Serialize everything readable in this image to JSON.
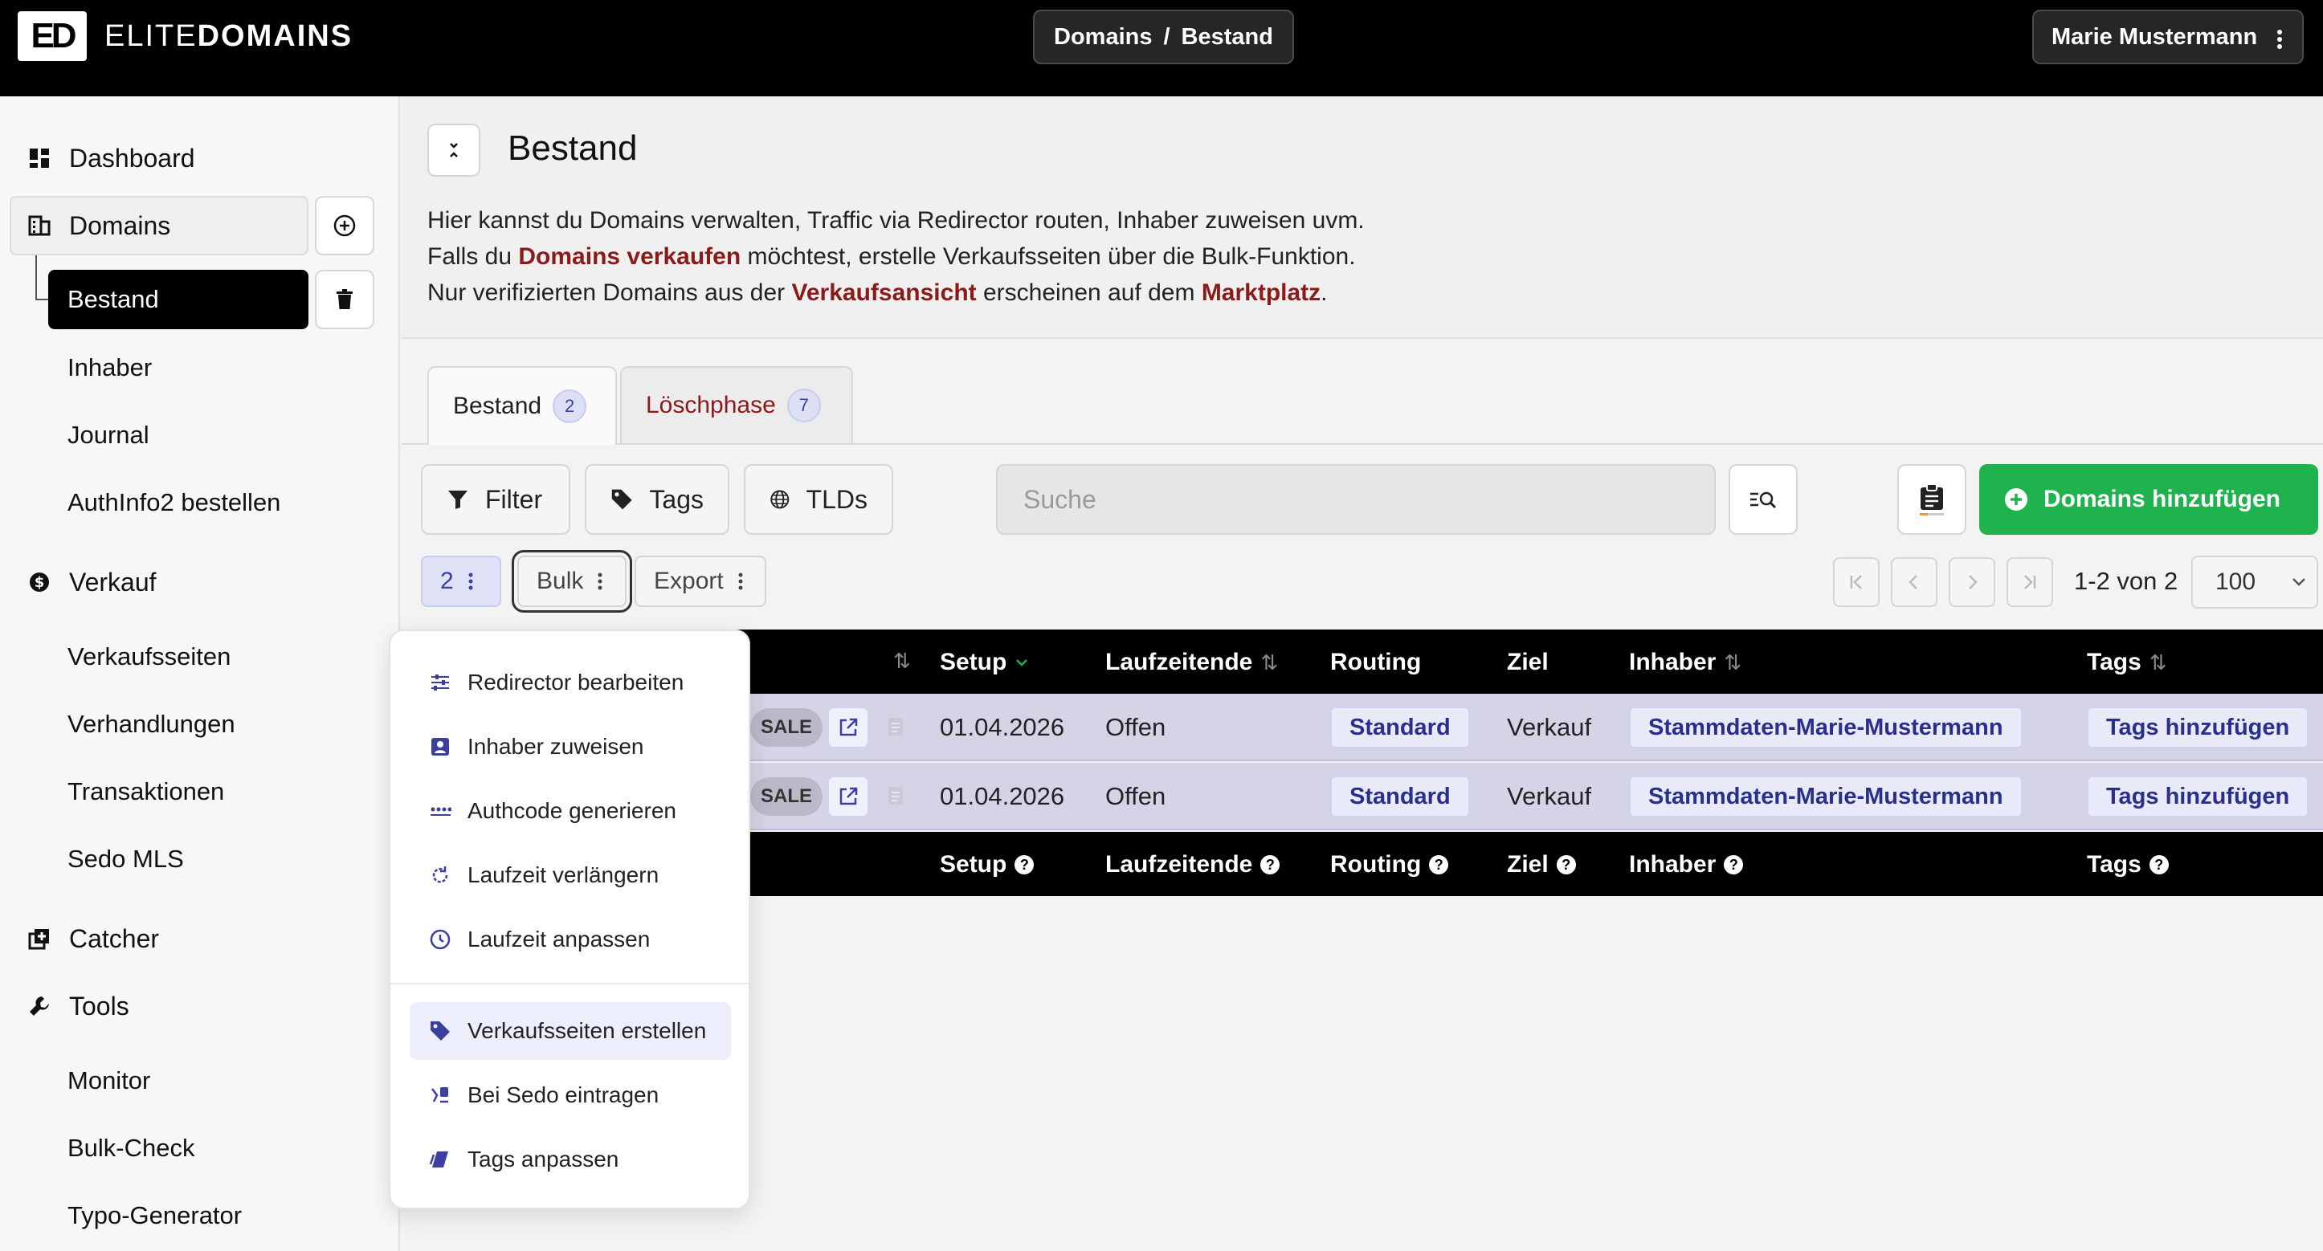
{
  "topbar": {
    "logo_mark": "ED",
    "logo_light": "ELITE",
    "logo_bold": "DOMAINS",
    "breadcrumb": [
      "Domains",
      "/",
      "Bestand"
    ],
    "user_name": "Marie Mustermann"
  },
  "sidebar": {
    "dashboard": "Dashboard",
    "domains": "Domains",
    "bestand": "Bestand",
    "inhaber": "Inhaber",
    "journal": "Journal",
    "authinfo": "AuthInfo2 bestellen",
    "verkauf": "Verkauf",
    "verkaufsseiten": "Verkaufsseiten",
    "verhandlungen": "Verhandlungen",
    "transaktionen": "Transaktionen",
    "sedo": "Sedo MLS",
    "catcher": "Catcher",
    "tools": "Tools",
    "monitor": "Monitor",
    "bulkcheck": "Bulk-Check",
    "typo": "Typo-Generator"
  },
  "header": {
    "title": "Bestand",
    "line1": "Hier kannst du Domains verwalten, Traffic via Redirector routen, Inhaber zuweisen uvm.",
    "line2_a": "Falls du ",
    "line2_link": "Domains verkaufen",
    "line2_b": " möchtest, erstelle Verkaufsseiten über die Bulk-Funktion.",
    "line3_a": "Nur verifizierten Domains aus der ",
    "line3_link1": "Verkaufsansicht",
    "line3_b": " erscheinen auf dem ",
    "line3_link2": "Marktplatz",
    "line3_c": "."
  },
  "tabs": [
    {
      "label": "Bestand",
      "count": "2"
    },
    {
      "label": "Löschphase",
      "count": "7"
    }
  ],
  "toolbar": {
    "filter": "Filter",
    "tags": "Tags",
    "tlds": "TLDs",
    "search_placeholder": "Suche",
    "add": "Domains hinzufügen",
    "selected_count": "2",
    "bulk": "Bulk",
    "export": "Export",
    "page_info": "1-2 von 2",
    "page_size": "100"
  },
  "table": {
    "headers": {
      "setup": "Setup",
      "laufzeitende": "Laufzeitende",
      "routing": "Routing",
      "ziel": "Ziel",
      "inhaber": "Inhaber",
      "tags": "Tags"
    },
    "rows": [
      {
        "sale": "SALE",
        "setup": "01.04.2026",
        "laufzeitende": "Offen",
        "routing": "Standard",
        "ziel": "Verkauf",
        "inhaber": "Stammdaten-Marie-Mustermann",
        "tags": "Tags hinzufügen"
      },
      {
        "sale": "SALE",
        "setup": "01.04.2026",
        "laufzeitende": "Offen",
        "routing": "Standard",
        "ziel": "Verkauf",
        "inhaber": "Stammdaten-Marie-Mustermann",
        "tags": "Tags hinzufügen"
      }
    ]
  },
  "bulk_menu": [
    {
      "label": "Redirector bearbeiten",
      "icon": "sliders-icon"
    },
    {
      "label": "Inhaber zuweisen",
      "icon": "contact-icon"
    },
    {
      "label": "Authcode generieren",
      "icon": "password-icon"
    },
    {
      "label": "Laufzeit verlängern",
      "icon": "renew-icon"
    },
    {
      "label": "Laufzeit anpassen",
      "icon": "clock-icon"
    },
    {
      "label": "Verkaufsseiten erstellen",
      "icon": "tag-icon"
    },
    {
      "label": "Bei Sedo eintragen",
      "icon": "sedo-icon"
    },
    {
      "label": "Tags anpassen",
      "icon": "tags-icon"
    }
  ],
  "colors": {
    "accent": "#3a3fa0",
    "link": "#8b1a1a",
    "add_button": "#1fb34d",
    "row_bg": "#d4d4e6"
  }
}
